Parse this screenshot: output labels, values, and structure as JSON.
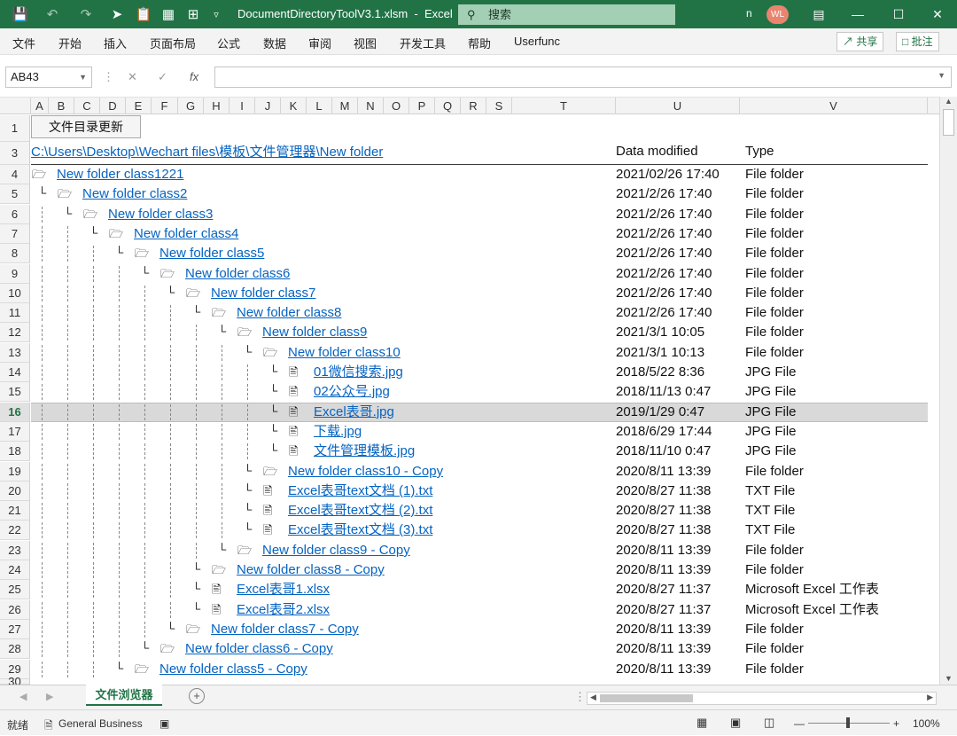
{
  "title_bar": {
    "file_title": "DocumentDirectoryToolV3.1.xlsm",
    "app_name": "Excel",
    "search_placeholder": "搜索",
    "user_initial": "n",
    "avatar_initials": "WL"
  },
  "menu": [
    "文件",
    "开始",
    "插入",
    "页面布局",
    "公式",
    "数据",
    "审阅",
    "视图",
    "开发工具",
    "帮助",
    "Userfunc"
  ],
  "share_label": "共享",
  "comment_label": "批注",
  "name_box": "AB43",
  "formula_value": "",
  "columns": [
    "A",
    "B",
    "C",
    "D",
    "E",
    "F",
    "G",
    "H",
    "I",
    "J",
    "K",
    "L",
    "M",
    "N",
    "O",
    "P",
    "Q",
    "R",
    "S",
    "T",
    "U",
    "V"
  ],
  "update_button": "文件目录更新",
  "path": "C:\\Users\\Desktop\\Wechart files\\模板\\文件管理器\\New folder",
  "headers": {
    "modified": "Data modified",
    "type": "Type"
  },
  "active_row": 16,
  "rows": [
    {
      "row": 4,
      "level": 0,
      "kind": "folder",
      "name": "New folder class1221",
      "date": "2021/02/26 17:40",
      "type": "File folder"
    },
    {
      "row": 5,
      "level": 1,
      "kind": "folder",
      "name": "New folder class2",
      "date": "2021/2/26 17:40",
      "type": "File folder"
    },
    {
      "row": 6,
      "level": 2,
      "kind": "folder",
      "name": "New folder class3",
      "date": "2021/2/26 17:40",
      "type": "File folder"
    },
    {
      "row": 7,
      "level": 3,
      "kind": "folder",
      "name": "New folder class4",
      "date": "2021/2/26 17:40",
      "type": "File folder"
    },
    {
      "row": 8,
      "level": 4,
      "kind": "folder",
      "name": "New folder class5",
      "date": "2021/2/26 17:40",
      "type": "File folder"
    },
    {
      "row": 9,
      "level": 5,
      "kind": "folder",
      "name": "New folder class6",
      "date": "2021/2/26 17:40",
      "type": "File folder"
    },
    {
      "row": 10,
      "level": 6,
      "kind": "folder",
      "name": "New folder class7",
      "date": "2021/2/26 17:40",
      "type": "File folder"
    },
    {
      "row": 11,
      "level": 7,
      "kind": "folder",
      "name": "New folder class8",
      "date": "2021/2/26 17:40",
      "type": "File folder"
    },
    {
      "row": 12,
      "level": 8,
      "kind": "folder",
      "name": "New folder class9",
      "date": "2021/3/1 10:05",
      "type": "File folder"
    },
    {
      "row": 13,
      "level": 9,
      "kind": "folder",
      "name": "New folder class10",
      "date": "2021/3/1 10:13",
      "type": "File folder"
    },
    {
      "row": 14,
      "level": 10,
      "kind": "file",
      "name": "01微信搜索.jpg",
      "date": "2018/5/22 8:36",
      "type": "JPG File"
    },
    {
      "row": 15,
      "level": 10,
      "kind": "file",
      "name": "02公众号.jpg",
      "date": "2018/11/13 0:47",
      "type": "JPG File"
    },
    {
      "row": 16,
      "level": 10,
      "kind": "file",
      "name": "Excel表哥.jpg",
      "date": "2019/1/29 0:47",
      "type": "JPG File"
    },
    {
      "row": 17,
      "level": 10,
      "kind": "file",
      "name": "下载.jpg",
      "date": "2018/6/29 17:44",
      "type": "JPG File"
    },
    {
      "row": 18,
      "level": 10,
      "kind": "file",
      "name": "文件管理模板.jpg",
      "date": "2018/11/10 0:47",
      "type": "JPG File"
    },
    {
      "row": 19,
      "level": 9,
      "kind": "folder",
      "name": "New folder class10 - Copy",
      "date": "2020/8/11 13:39",
      "type": "File folder"
    },
    {
      "row": 20,
      "level": 9,
      "kind": "file",
      "name": "Excel表哥text文档 (1).txt",
      "date": "2020/8/27 11:38",
      "type": "TXT File"
    },
    {
      "row": 21,
      "level": 9,
      "kind": "file",
      "name": "Excel表哥text文档 (2).txt",
      "date": "2020/8/27 11:38",
      "type": "TXT File"
    },
    {
      "row": 22,
      "level": 9,
      "kind": "file",
      "name": "Excel表哥text文档 (3).txt",
      "date": "2020/8/27 11:38",
      "type": "TXT File"
    },
    {
      "row": 23,
      "level": 8,
      "kind": "folder",
      "name": "New folder class9 - Copy",
      "date": "2020/8/11 13:39",
      "type": "File folder"
    },
    {
      "row": 24,
      "level": 7,
      "kind": "folder",
      "name": "New folder class8 - Copy",
      "date": "2020/8/11 13:39",
      "type": "File folder"
    },
    {
      "row": 25,
      "level": 7,
      "kind": "file",
      "name": "Excel表哥1.xlsx",
      "date": "2020/8/27 11:37",
      "type": "Microsoft Excel 工作表"
    },
    {
      "row": 26,
      "level": 7,
      "kind": "file",
      "name": "Excel表哥2.xlsx",
      "date": "2020/8/27 11:37",
      "type": "Microsoft Excel 工作表"
    },
    {
      "row": 27,
      "level": 6,
      "kind": "folder",
      "name": "New folder class7 - Copy",
      "date": "2020/8/11 13:39",
      "type": "File folder"
    },
    {
      "row": 28,
      "level": 5,
      "kind": "folder",
      "name": "New folder class6 - Copy",
      "date": "2020/8/11 13:39",
      "type": "File folder"
    },
    {
      "row": 29,
      "level": 4,
      "kind": "folder",
      "name": "New folder class5 - Copy",
      "date": "2020/8/11 13:39",
      "type": "File folder"
    }
  ],
  "sheet_tab": "文件浏览器",
  "status": {
    "ready": "就绪",
    "label": "General Business",
    "zoom": "100%"
  }
}
